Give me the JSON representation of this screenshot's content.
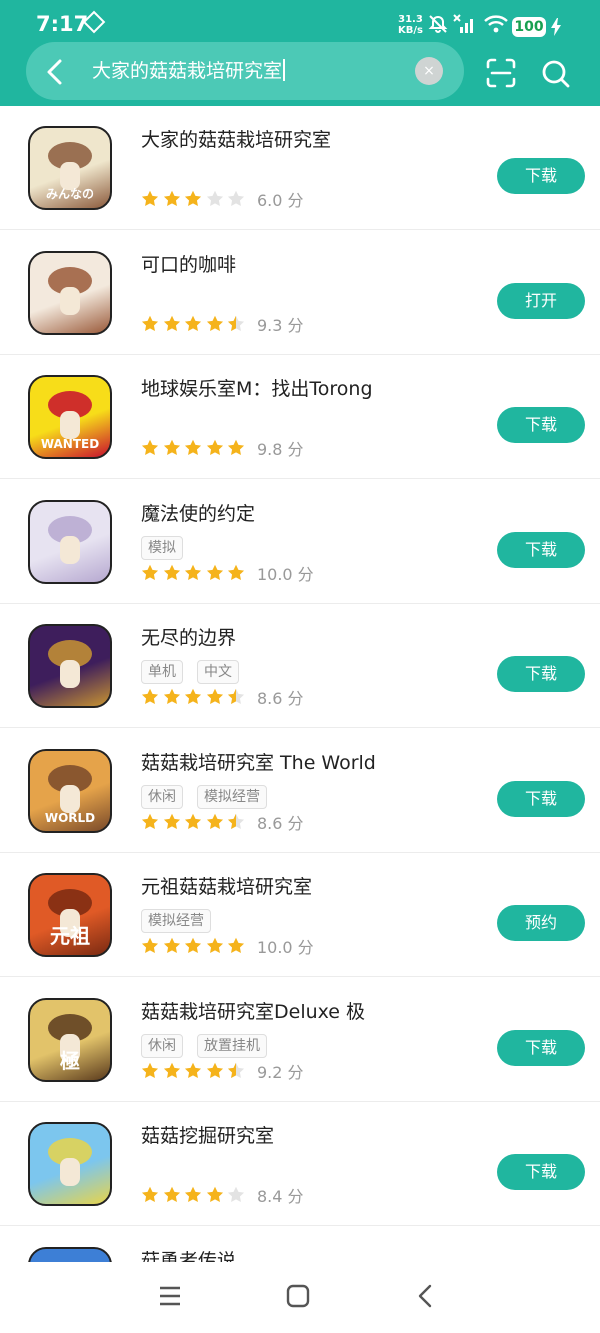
{
  "status_bar": {
    "time": "7:17",
    "net_speed_value": "31.3",
    "net_speed_unit": "KB/s",
    "battery": "100"
  },
  "search": {
    "query": "大家的菇菇栽培研究室",
    "clear_label": "×"
  },
  "apps": [
    {
      "title": "大家的菇菇栽培研究室",
      "tags": [],
      "stars": 3,
      "score": "6.0 分",
      "button": "下载",
      "icon_text": "みんなの",
      "icon_colors": [
        "#efe6cc",
        "#8b5a3c"
      ]
    },
    {
      "title": "可口的咖啡",
      "tags": [],
      "stars": 4.5,
      "score": "9.3 分",
      "button": "打开",
      "icon_text": "",
      "icon_colors": [
        "#f3e9dd",
        "#9a5a3a"
      ]
    },
    {
      "title": "地球娱乐室M：找出Torong",
      "tags": [],
      "stars": 5,
      "score": "9.8 分",
      "button": "下载",
      "icon_text": "WANTED",
      "icon_colors": [
        "#f7dd19",
        "#c8102e"
      ]
    },
    {
      "title": "魔法使的约定",
      "tags": [
        "模拟"
      ],
      "stars": 5,
      "score": "10.0 分",
      "button": "下载",
      "icon_text": "",
      "icon_colors": [
        "#e7e3f1",
        "#b6a8d0"
      ]
    },
    {
      "title": "无尽的边界",
      "tags": [
        "单机",
        "中文"
      ],
      "stars": 4.5,
      "score": "8.6 分",
      "button": "下载",
      "icon_text": "",
      "icon_colors": [
        "#3e1e5c",
        "#c89432"
      ]
    },
    {
      "title": "菇菇栽培研究室 The World",
      "tags": [
        "休闲",
        "模拟经营"
      ],
      "stars": 4.5,
      "score": "8.6 分",
      "button": "下载",
      "icon_text": "WORLD",
      "icon_colors": [
        "#e5a34a",
        "#7a4a2a"
      ]
    },
    {
      "title": "元祖菇菇栽培研究室",
      "tags": [
        "模拟经营"
      ],
      "stars": 5,
      "score": "10.0 分",
      "button": "预约",
      "icon_text": "元祖",
      "icon_colors": [
        "#e05a26",
        "#7a2a12"
      ]
    },
    {
      "title": "菇菇栽培研究室Deluxe 极",
      "tags": [
        "休闲",
        "放置挂机"
      ],
      "stars": 4.5,
      "score": "9.2 分",
      "button": "下载",
      "icon_text": "極",
      "icon_colors": [
        "#e2c36a",
        "#5b3b1d"
      ]
    },
    {
      "title": "菇菇挖掘研究室",
      "tags": [],
      "stars": 4,
      "score": "8.4 分",
      "button": "下载",
      "icon_text": "",
      "icon_colors": [
        "#7cc6ee",
        "#e8d44a"
      ]
    },
    {
      "title": "菇勇者传说",
      "tags": [],
      "stars": 0,
      "score": "",
      "button": "",
      "icon_text": "",
      "icon_colors": [
        "#3d7fd6",
        "#f2d94a"
      ]
    }
  ],
  "colors": {
    "accent": "#20b69f",
    "star_on": "#f5b31b",
    "star_off": "#e3e3e3"
  },
  "icons": {
    "back": "chevron-left-icon",
    "scan": "scan-icon",
    "search": "search-icon",
    "nav_menu": "menu-icon",
    "nav_home": "home-icon",
    "nav_back": "back-icon"
  }
}
